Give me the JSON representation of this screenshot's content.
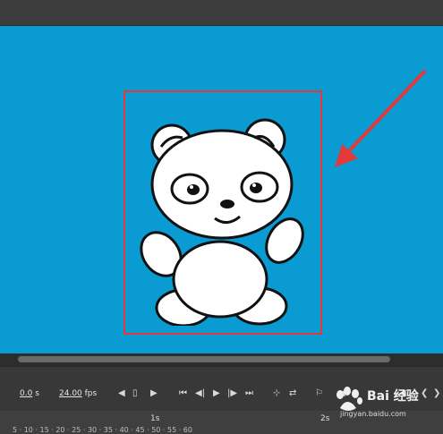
{
  "controls": {
    "time_value": "0.0",
    "time_unit": "s",
    "fps_value": "24.00",
    "fps_unit": "fps"
  },
  "ruler": {
    "markers": [
      "1s",
      "2s"
    ],
    "frame_numbers": "5 · 10 · 15 · 20 · 25 · 30 · 35 · 40 · 45 · 50 · 55 · 60"
  },
  "watermark": {
    "brand": "Bai 经验",
    "url": "jingyan.baidu.com"
  }
}
